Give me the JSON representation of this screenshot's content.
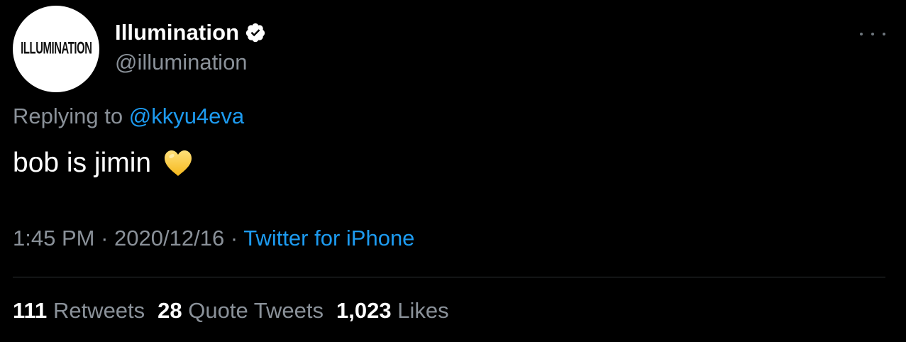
{
  "author": {
    "avatar_logo_text": "ILLUMINATION",
    "display_name": "Illumination",
    "handle": "@illumination",
    "verified_icon": "verified-badge-icon"
  },
  "reply": {
    "prefix": "Replying to",
    "mention": "@kkyu4eva"
  },
  "tweet": {
    "text": "bob is jimin",
    "emoji_icon": "yellow-heart-icon"
  },
  "meta": {
    "time": "1:45 PM",
    "separator": "·",
    "date": "2020/12/16",
    "source": "Twitter for iPhone"
  },
  "stats": {
    "retweets_count": "111",
    "retweets_label": "Retweets",
    "quotes_count": "28",
    "quotes_label": "Quote Tweets",
    "likes_count": "1,023",
    "likes_label": "Likes"
  },
  "colors": {
    "background": "#000000",
    "primary_text": "#ffffff",
    "secondary_text": "#8a9199",
    "link": "#1d9bf0",
    "divider": "#2f3336"
  }
}
